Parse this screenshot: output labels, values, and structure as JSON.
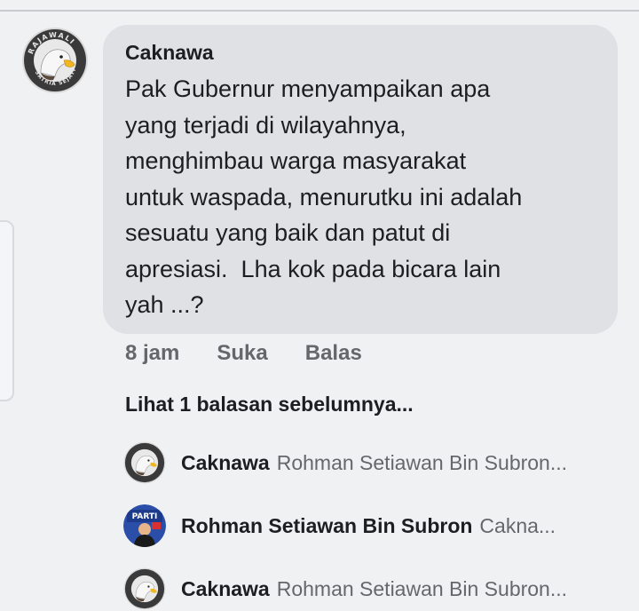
{
  "comment": {
    "author": "Caknawa",
    "avatar_text_top": "RAJAWALI",
    "avatar_text_bottom": "SATRIA SEJATI",
    "text": "Pak Gubernur menyampaikan apa\nyang terjadi di wilayahnya,\nmenghimbau warga masyarakat\nuntuk waspada, menurutku ini adalah\nsesuatu yang baik dan patut di\napresiasi.  Lha kok pada bicara lain\nyah ...?",
    "time": "8 jam",
    "like_label": "Suka",
    "reply_label": "Balas"
  },
  "view_previous": "Lihat 1 balasan sebelumnya...",
  "replies": [
    {
      "author": "Caknawa",
      "snippet": "Rohman Setiawan Bin Subron..."
    },
    {
      "author": "Rohman Setiawan Bin Subron",
      "avatar_text": "PARTI",
      "snippet": "Cakna..."
    },
    {
      "author": "Caknawa",
      "snippet": "Rohman Setiawan Bin Subron..."
    }
  ],
  "colors": {
    "background": "#f0f1f3",
    "bubble": "#dfe1e5",
    "primary_text": "#1c1e21",
    "secondary_text": "#65676b"
  }
}
